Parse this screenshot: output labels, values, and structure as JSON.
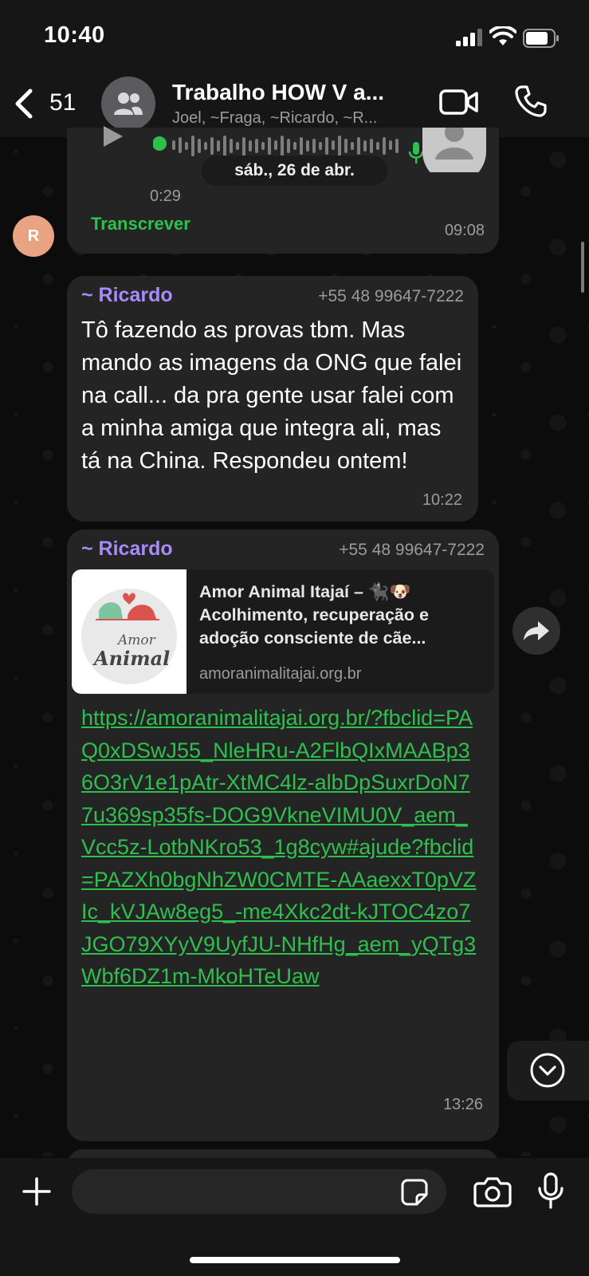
{
  "status_bar": {
    "time": "10:40"
  },
  "header": {
    "back_count": "51",
    "title": "Trabalho HOW V a...",
    "subtitle": "Joel, ~Fraga, ~Ricardo, ~R..."
  },
  "voice_message": {
    "duration": "0:29",
    "transcribe_label": "Transcrever",
    "time": "09:08"
  },
  "date_separator": "sáb., 26 de abr.",
  "sender_avatar_letter": "R",
  "message1": {
    "sender": "~ Ricardo",
    "phone": "+55 48 99647-7222",
    "text": "Tô fazendo as provas tbm. Mas mando as imagens da ONG que falei na call... da pra gente usar falei com a minha amiga que integra ali, mas tá na China. Respondeu ontem!",
    "time": "10:22"
  },
  "message2": {
    "sender": "~ Ricardo",
    "phone": "+55 48 99647-7222",
    "preview_title": "Amor Animal Itajaí – 🐈‍⬛🐶 Acolhimento, recuperação e adoção consciente de cãe...",
    "preview_domain": "amoranimalitajai.org.br",
    "preview_logo_text1": "Amor",
    "preview_logo_text2": "Animal",
    "url": "https://amoranimalitajai.org.br/?fbclid=PAQ0xDSwJ55_NleHRu-A2FlbQIxMAABp36O3rV1e1pAtr-XtMC4lz-albDpSuxrDoN77u369sp35fs-DOG9VkneVIMU0V_aem_Vcc5z-LotbNKro53_1g8cyw#ajude?fbclid=PAZXh0bgNhZW0CMTE-AAaexxT0pVZIc_kVJAw8eg5_-me4Xkc2dt-kJTOC4zo7JGO79XYyV9UyfJU-NHfHg_aem_yQTg3Wbf6DZ1m-MkoHTeUaw",
    "time": "13:26"
  },
  "input": {
    "placeholder": ""
  },
  "colors": {
    "accent_green": "#2ec04f",
    "sender_purple": "#a78bfa",
    "bubble": "#242424",
    "background": "#0c0c0c"
  }
}
